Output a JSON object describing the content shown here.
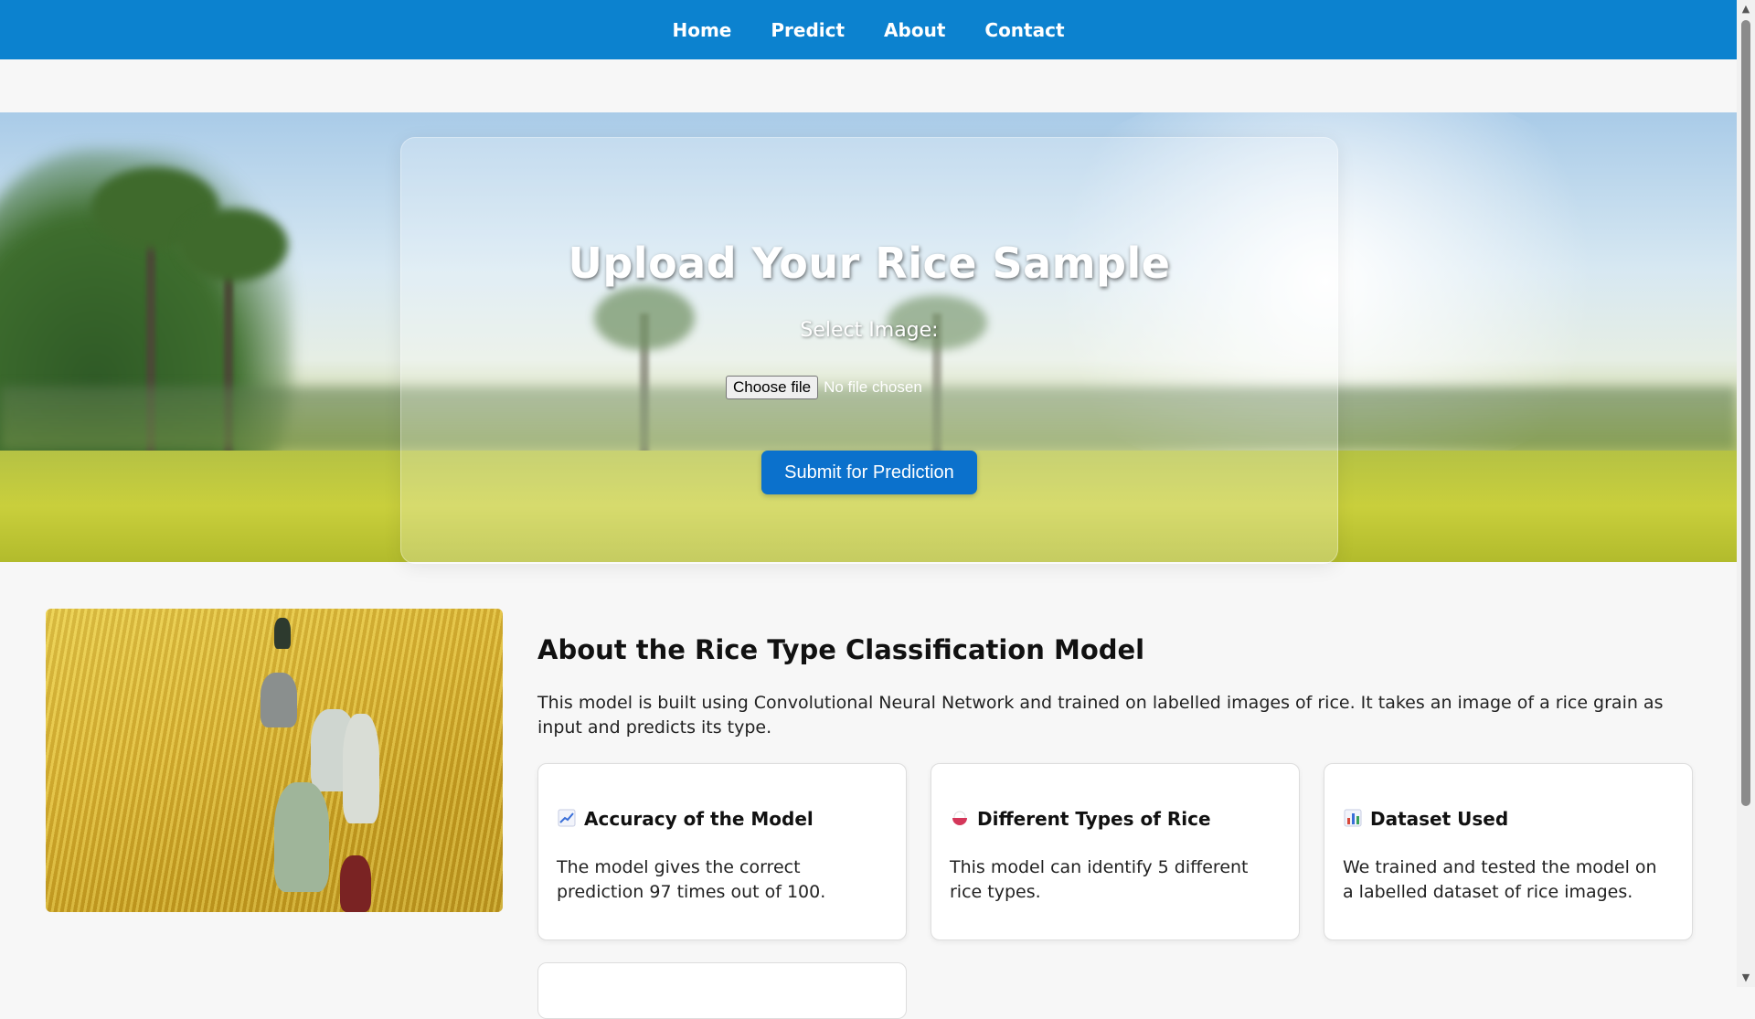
{
  "nav": {
    "items": [
      {
        "label": "Home"
      },
      {
        "label": "Predict"
      },
      {
        "label": "About"
      },
      {
        "label": "Contact"
      }
    ]
  },
  "upload": {
    "title": "Upload Your Rice Sample",
    "select_label": "Select Image:",
    "file_button": "Choose file",
    "file_status": "No file chosen",
    "submit_label": "Submit for Prediction"
  },
  "about": {
    "title": "About the Rice Type Classification Model",
    "description": "This model is built using Convolutional Neural Network and trained on labelled images of rice. It takes an image of a rice grain as input and predicts its type.",
    "cards": [
      {
        "icon": "chart-increasing-icon",
        "title": "Accuracy of the Model",
        "text": "The model gives the correct prediction 97 times out of 100."
      },
      {
        "icon": "rice-bowl-icon",
        "title": "Different Types of Rice",
        "text": "This model can identify 5 different rice types."
      },
      {
        "icon": "bar-chart-icon",
        "title": "Dataset Used",
        "text": "We trained and tested the model on a labelled dataset of rice images."
      }
    ]
  },
  "colors": {
    "nav_bg": "#0c82cf",
    "button_bg": "#0b71cc"
  }
}
